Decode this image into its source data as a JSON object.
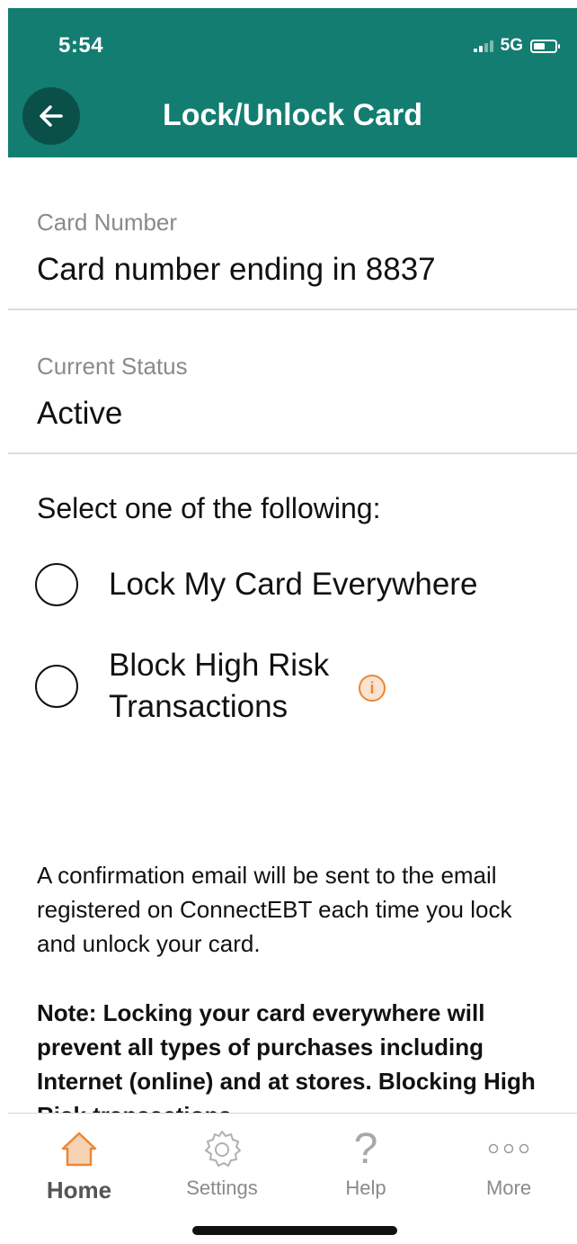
{
  "status_bar": {
    "time": "5:54",
    "network": "5G"
  },
  "header": {
    "title": "Lock/Unlock Card",
    "back_icon": "arrow-left-icon"
  },
  "card_number": {
    "label": "Card Number",
    "value": "Card number ending in 8837"
  },
  "current_status": {
    "label": "Current Status",
    "value": "Active"
  },
  "selection": {
    "prompt": "Select one of the following:",
    "options": [
      {
        "label": "Lock My Card Everywhere",
        "selected": false
      },
      {
        "label_line1": "Block High Risk",
        "label_line2": "Transactions",
        "selected": false,
        "info_icon": "info-icon"
      }
    ]
  },
  "confirmation_text": "A confirmation email will be sent to the email registered on ConnectEBT each time you lock and unlock your card.",
  "note_text": "Note: Locking your card everywhere will prevent all types of purchases including Internet (online) and at stores. Blocking High Risk transactions",
  "tabbar": {
    "items": [
      {
        "label": "Home",
        "icon": "home-icon",
        "active": true
      },
      {
        "label": "Settings",
        "icon": "gear-icon",
        "active": false
      },
      {
        "label": "Help",
        "icon": "question-mark-icon",
        "active": false
      },
      {
        "label": "More",
        "icon": "more-dots-icon",
        "active": false
      }
    ]
  },
  "colors": {
    "header_bg": "#137d72",
    "back_button_bg": "#0b4f49",
    "accent_orange": "#e8883a",
    "home_icon_fill": "#f7d3b5"
  }
}
